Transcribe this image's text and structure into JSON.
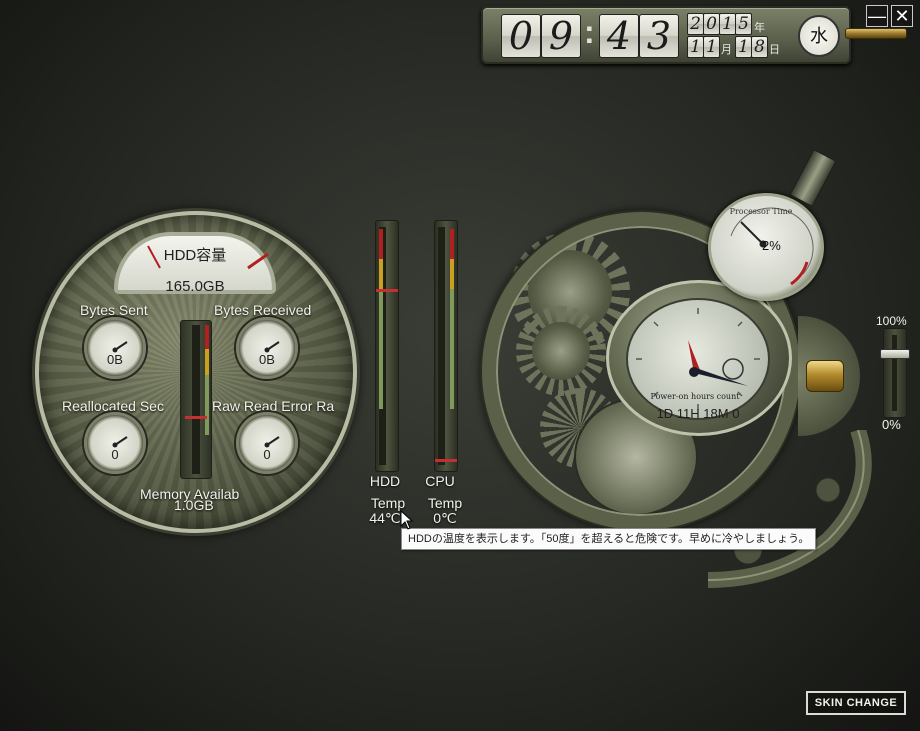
{
  "clock": {
    "h1": "0",
    "h2": "9",
    "colon": ":",
    "m1": "4",
    "m2": "3",
    "y": [
      "2",
      "0",
      "1",
      "5"
    ],
    "year_kanji": "年",
    "month": [
      "1",
      "1"
    ],
    "month_kanji": "月",
    "day": [
      "1",
      "8"
    ],
    "day_kanji": "日",
    "weekday": "水"
  },
  "window": {
    "minimize": "—",
    "close": "✕"
  },
  "left_panel": {
    "hdd_title": "HDD容量",
    "hdd_value": "165.0GB",
    "bytes_sent_label": "Bytes Sent",
    "bytes_sent_value": "0B",
    "bytes_received_label": "Bytes Received",
    "bytes_received_value": "0B",
    "realloc_label": "Reallocated Sec",
    "realloc_value": "0",
    "raw_read_label": "Raw Read Error Ra",
    "raw_read_value": "0",
    "memory_label": "Memory Availab",
    "memory_value": "1.0GB"
  },
  "temps": {
    "hdd_label1": "HDD",
    "hdd_label2": "Temp",
    "hdd_value": "44℃",
    "cpu_label1": "CPU",
    "cpu_label2": "Temp",
    "cpu_value": "0℃"
  },
  "right_panel": {
    "processor_title": "Processor Time",
    "processor_value": "2%",
    "poh_label": "Power-on hours count",
    "poh_value": "1D 11H 18M 0"
  },
  "slider": {
    "max_label": "100%",
    "min_label": "0%"
  },
  "tooltip": "HDDの温度を表示します。「50度」を超えると危険です。早めに冷やしましょう。",
  "skin_change": "SKIN CHANGE",
  "colors": {
    "red": "#b02020",
    "yellow": "#c9a020",
    "green": "#7f9a5a",
    "brass": "#b38b2c"
  }
}
